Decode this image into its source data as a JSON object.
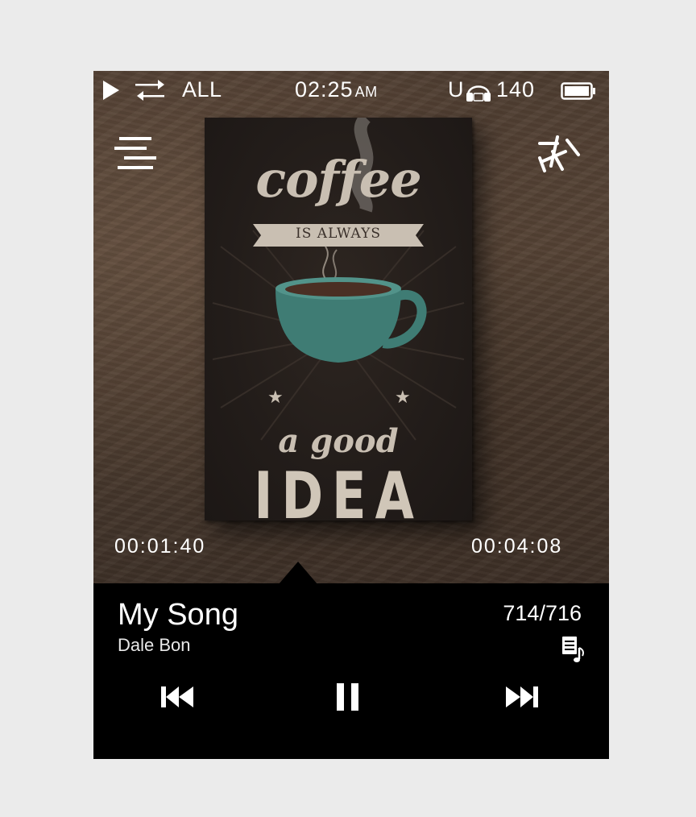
{
  "status_bar": {
    "play_icon": "play-icon",
    "repeat_icon": "repeat-icon",
    "repeat_mode": "ALL",
    "time": "02:25",
    "ampm": "AM",
    "output": "U",
    "headphone_icon": "headphone-icon",
    "volume": "140",
    "battery_icon": "battery-icon",
    "battery_level": 1.0
  },
  "toolbar": {
    "menu_icon": "menu-icon",
    "shuffle_icon": "shuffle-icon"
  },
  "album_art": {
    "line1": "coffee",
    "line2": "IS ALWAYS",
    "line3": "a good",
    "line4": "IDEA"
  },
  "progress": {
    "elapsed": "00:01:40",
    "total": "00:04:08"
  },
  "track": {
    "title": "My Song",
    "artist": "Dale Bon",
    "counter": "714/716",
    "queue_icon": "playlist-icon"
  },
  "controls": {
    "prev_icon": "previous-icon",
    "pause_icon": "pause-icon",
    "next_icon": "next-icon"
  },
  "colors": {
    "background": "#ebebeb",
    "panel": "#000000",
    "text": "#ffffff",
    "cup": "#3f7c74"
  }
}
